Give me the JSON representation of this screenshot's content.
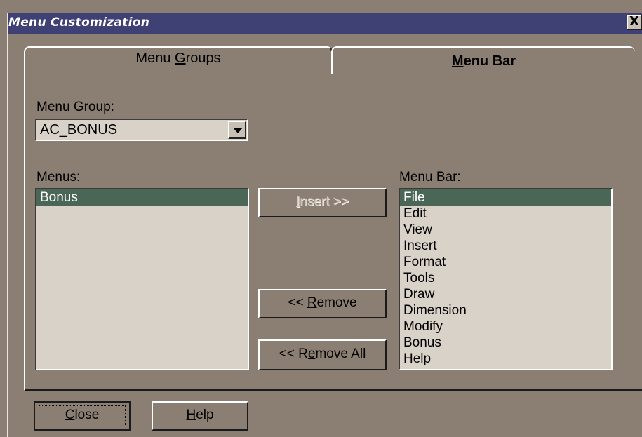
{
  "window": {
    "title": "Menu Customization",
    "close_glyph": "X"
  },
  "tabs": [
    {
      "label_pre": "Menu ",
      "label_u": "G",
      "label_post": "roups",
      "active": false
    },
    {
      "label_pre": "",
      "label_u": "M",
      "label_post": "enu Bar",
      "active": true
    }
  ],
  "menu_group": {
    "label_pre": "Me",
    "label_u": "n",
    "label_post": "u Group:",
    "value": "AC_BONUS"
  },
  "menus": {
    "label_pre": "Men",
    "label_u": "u",
    "label_post": "s:",
    "items": [
      "Bonus"
    ],
    "selected": 0
  },
  "menu_bar": {
    "label_pre": "Menu ",
    "label_u": "B",
    "label_post": "ar:",
    "items": [
      "File",
      "Edit",
      "View",
      "Insert",
      "Format",
      "Tools",
      "Draw",
      "Dimension",
      "Modify",
      "Bonus",
      "Help"
    ],
    "selected": 0
  },
  "buttons": {
    "insert": {
      "pre": "",
      "u": "I",
      "post": "nsert >>",
      "enabled": false
    },
    "remove": {
      "pre": "<< ",
      "u": "R",
      "post": "emove",
      "enabled": true
    },
    "remove_all": {
      "pre": "<< R",
      "u": "e",
      "post": "move All",
      "enabled": true
    },
    "close": {
      "pre": "",
      "u": "C",
      "post": "lose"
    },
    "help": {
      "pre": "",
      "u": "H",
      "post": "elp"
    }
  },
  "colors": {
    "face": "#8a7f72",
    "titlebar": "#3f4073",
    "list_bg": "#d9d2c8",
    "selection": "#496656"
  }
}
